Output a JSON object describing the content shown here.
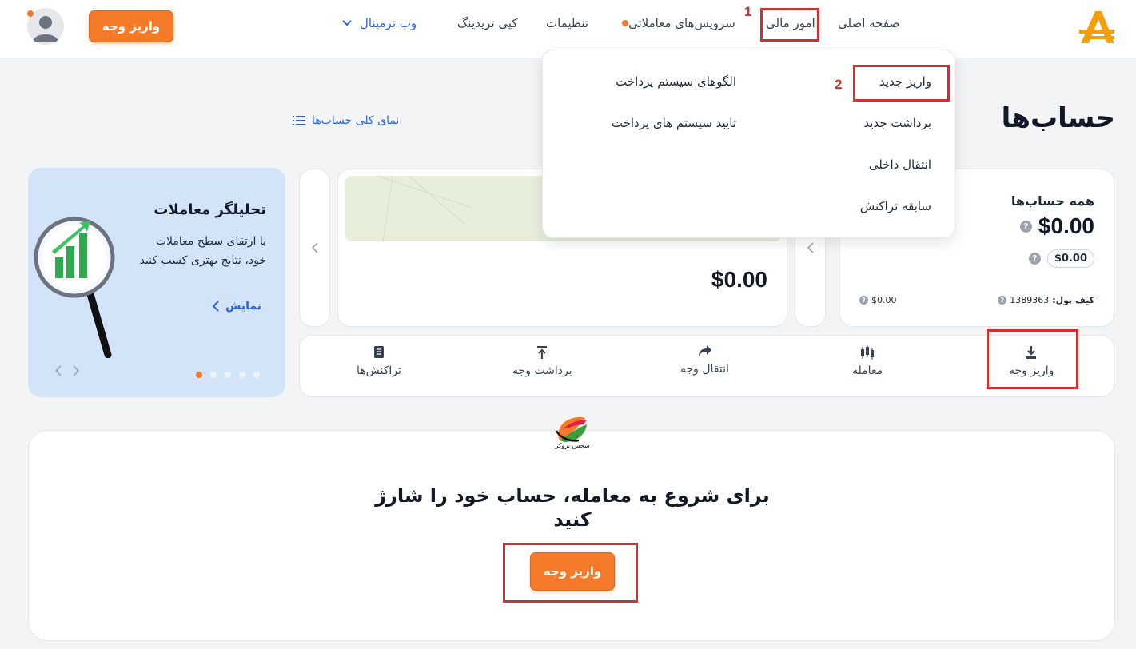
{
  "header": {
    "nav": {
      "home": "صفحه اصلی",
      "finance": "امور مالی",
      "services": "سرویس‌های معاملاتی",
      "settings": "تنظیمات",
      "copy_trading": "کپی تریدینگ",
      "web_terminal": "وب ترمینال"
    },
    "deposit_button": "واریز وجه"
  },
  "annotations": {
    "step1": "1",
    "step2": "2"
  },
  "dropdown": {
    "new_deposit": "واریز جدید",
    "new_withdraw": "برداشت جدید",
    "internal_transfer": "انتقال داخلی",
    "transaction_history": "سابقه تراکنش",
    "payment_patterns": "الگوهای سیستم پرداخت",
    "payment_verification": "تایید سیستم های پرداخت"
  },
  "page": {
    "title": "حساب‌ها",
    "overview_link": "نمای کلی حساب‌ها"
  },
  "summary": {
    "title": "همه حساب‌ها",
    "total": "$0.00",
    "sub_total": "$0.00",
    "wallet_label": "کیف پول:",
    "wallet_id": "1389363",
    "wallet_balance": "$0.00"
  },
  "account_card": {
    "balance": "$0.00"
  },
  "actions": {
    "deposit": "واریز وجه",
    "trade": "معامله",
    "transfer": "انتقال وجه",
    "withdraw": "برداشت وجه",
    "transactions": "تراکنش‌ها"
  },
  "promo": {
    "title": "تحلیلگر معاملات",
    "body": "با ارتقای سطح معاملات خود، نتایج بهتری کسب کنید",
    "link": "نمایش",
    "slide_count": 5,
    "active_slide": 1
  },
  "cta": {
    "watermark": "سجس بروکر",
    "title": "برای شروع به معامله، حساب خود را شارژ کنید",
    "button": "واریز وجه"
  },
  "colors": {
    "accent": "#f47a2a",
    "link": "#2563eb",
    "annotation": "#d32f2f",
    "promo_bg": "#d3e3f8"
  }
}
